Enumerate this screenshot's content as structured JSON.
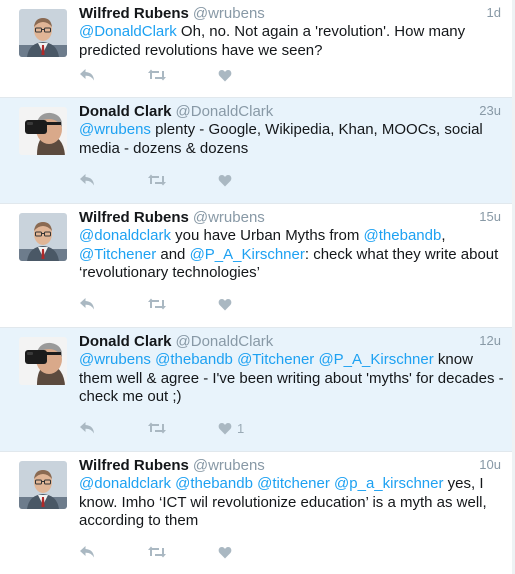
{
  "colors": {
    "mention": "#1da1f2",
    "muted": "#8899a6",
    "highlight_bg": "#e8f3fb",
    "action_icon": "#aab8c2"
  },
  "tweets": [
    {
      "name": "Wilfred Rubens",
      "handle": "@wrubens",
      "time": "1d",
      "highlighted": false,
      "avatar": "man-with-glasses",
      "segments": [
        {
          "t": "@DonaldClark",
          "m": true
        },
        {
          "t": " Oh, no. Not again a 'revolution'. How many predicted revolutions have we seen?",
          "m": false
        }
      ],
      "likes": ""
    },
    {
      "name": "Donald Clark",
      "handle": "@DonaldClark",
      "time": "23u",
      "highlighted": true,
      "avatar": "vr-headset",
      "segments": [
        {
          "t": "@wrubens",
          "m": true
        },
        {
          "t": " plenty - Google, Wikipedia, Khan, MOOCs, social media - dozens & dozens",
          "m": false
        }
      ],
      "likes": ""
    },
    {
      "name": "Wilfred Rubens",
      "handle": "@wrubens",
      "time": "15u",
      "highlighted": false,
      "avatar": "man-with-glasses",
      "segments": [
        {
          "t": "@donaldclark",
          "m": true
        },
        {
          "t": " you have Urban Myths from ",
          "m": false
        },
        {
          "t": "@thebandb",
          "m": true
        },
        {
          "t": ", ",
          "m": false
        },
        {
          "t": "@Titchener",
          "m": true
        },
        {
          "t": " and ",
          "m": false
        },
        {
          "t": "@P_A_Kirschner",
          "m": true
        },
        {
          "t": ": check what they write about ‘revolutionary technologies’",
          "m": false
        }
      ],
      "likes": ""
    },
    {
      "name": "Donald Clark",
      "handle": "@DonaldClark",
      "time": "12u",
      "highlighted": true,
      "avatar": "vr-headset",
      "segments": [
        {
          "t": "@wrubens",
          "m": true
        },
        {
          "t": " ",
          "m": false
        },
        {
          "t": "@thebandb",
          "m": true
        },
        {
          "t": " ",
          "m": false
        },
        {
          "t": "@Titchener",
          "m": true
        },
        {
          "t": " ",
          "m": false
        },
        {
          "t": "@P_A_Kirschner",
          "m": true
        },
        {
          "t": " know them well & agree - I've been writing about 'myths' for decades - check me out ;)",
          "m": false
        }
      ],
      "likes": "1"
    },
    {
      "name": "Wilfred Rubens",
      "handle": "@wrubens",
      "time": "10u",
      "highlighted": false,
      "avatar": "man-with-glasses",
      "segments": [
        {
          "t": "@donaldclark",
          "m": true
        },
        {
          "t": " ",
          "m": false
        },
        {
          "t": "@thebandb",
          "m": true
        },
        {
          "t": " ",
          "m": false
        },
        {
          "t": "@titchener",
          "m": true
        },
        {
          "t": " ",
          "m": false
        },
        {
          "t": "@p_a_kirschner",
          "m": true
        },
        {
          "t": " yes, I know. Imho ‘ICT wil revolutionize education’ is a myth as well, according to them",
          "m": false
        }
      ],
      "likes": ""
    }
  ]
}
